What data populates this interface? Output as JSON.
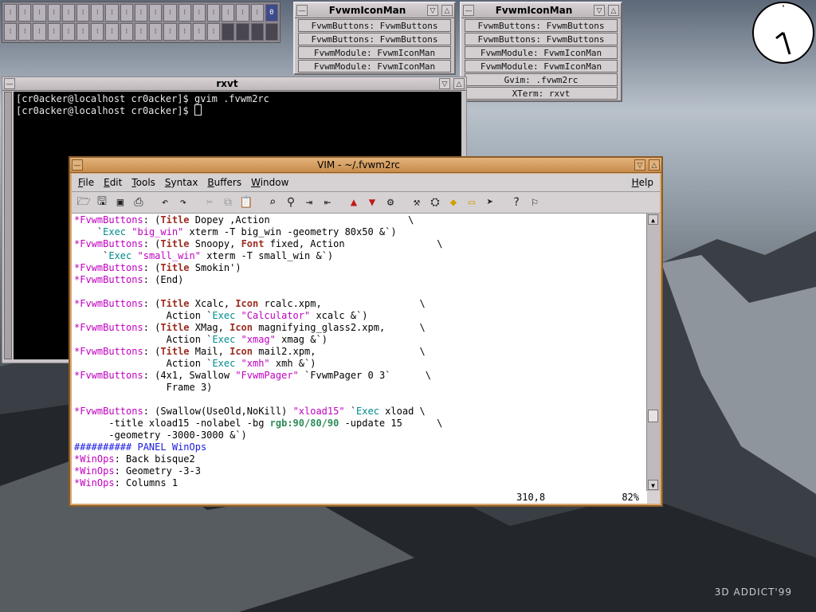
{
  "desktop": {
    "watermark": "3D ADDICT'99"
  },
  "pager": {
    "active_label": "0"
  },
  "iconman_left": {
    "title": "FvwmIconMan",
    "items": [
      "FvwmButtons: FvwmButtons",
      "FvwmButtons: FvwmButtons",
      "FvwmModule: FvwmIconMan",
      "FvwmModule: FvwmIconMan"
    ]
  },
  "iconman_right": {
    "title": "FvwmIconMan",
    "items": [
      "FvwmButtons: FvwmButtons",
      "FvwmButtons: FvwmButtons",
      "FvwmModule: FvwmIconMan",
      "FvwmModule: FvwmIconMan",
      "Gvim: .fvwm2rc",
      "XTerm: rxvt"
    ]
  },
  "rxvt": {
    "title": "rxvt",
    "line1": "[cr0acker@localhost cr0acker]$ gvim .fvwm2rc",
    "line2": "[cr0acker@localhost cr0acker]$ "
  },
  "vim": {
    "title": "VIM - ~/.fvwm2rc",
    "menu": [
      "File",
      "Edit",
      "Tools",
      "Syntax",
      "Buffers",
      "Window"
    ],
    "help": "Help",
    "toolbar_icons": [
      "open-icon",
      "save-icon",
      "save-all-icon",
      "print-icon",
      "undo-icon",
      "redo-icon",
      "cut-icon",
      "copy-icon",
      "paste-icon",
      "find-icon",
      "find-replace-icon",
      "find-next-icon",
      "find-prev-icon",
      "load-session-icon",
      "save-session-icon",
      "run-script-icon",
      "make-icon",
      "build-icon",
      "tags-icon",
      "shell-icon",
      "jump-tag-icon",
      "help-icon",
      "find-help-icon"
    ],
    "status_position": "310,8",
    "status_percent": "82%",
    "code_lines": [
      [
        [
          "*",
          "s"
        ],
        [
          "FvwmButtons",
          "k"
        ],
        [
          ": (",
          ""
        ],
        [
          "Title",
          "t"
        ],
        [
          " Dopey ,Action                        \\",
          ""
        ]
      ],
      [
        [
          "    `",
          ""
        ],
        [
          "Exec",
          "e"
        ],
        [
          " ",
          ""
        ],
        [
          "\"big_win\"",
          "q"
        ],
        [
          " xterm -T big_win -geometry 80x50 &`)",
          ""
        ]
      ],
      [
        [
          "*",
          "s"
        ],
        [
          "FvwmButtons",
          "k"
        ],
        [
          ": (",
          ""
        ],
        [
          "Title",
          "t"
        ],
        [
          " Snoopy, ",
          ""
        ],
        [
          "Font",
          "t"
        ],
        [
          " fixed, Action                \\",
          ""
        ]
      ],
      [
        [
          "     `",
          ""
        ],
        [
          "Exec",
          "e"
        ],
        [
          " ",
          ""
        ],
        [
          "\"small_win\"",
          "q"
        ],
        [
          " xterm -T small_win &`)",
          ""
        ]
      ],
      [
        [
          "*",
          "s"
        ],
        [
          "FvwmButtons",
          "k"
        ],
        [
          ": (",
          ""
        ],
        [
          "Title",
          "t"
        ],
        [
          " Smokin')",
          ""
        ]
      ],
      [
        [
          "*",
          "s"
        ],
        [
          "FvwmButtons",
          "k"
        ],
        [
          ": (End)",
          ""
        ]
      ],
      [
        [
          "",
          ""
        ]
      ],
      [
        [
          "*",
          "s"
        ],
        [
          "FvwmButtons",
          "k"
        ],
        [
          ": (",
          ""
        ],
        [
          "Title",
          "t"
        ],
        [
          " Xcalc, ",
          ""
        ],
        [
          "Icon",
          "t"
        ],
        [
          " rcalc.xpm,                 \\",
          ""
        ]
      ],
      [
        [
          "                Action `",
          ""
        ],
        [
          "Exec",
          "e"
        ],
        [
          " ",
          ""
        ],
        [
          "\"Calculator\"",
          "q"
        ],
        [
          " xcalc &`)",
          ""
        ]
      ],
      [
        [
          "*",
          "s"
        ],
        [
          "FvwmButtons",
          "k"
        ],
        [
          ": (",
          ""
        ],
        [
          "Title",
          "t"
        ],
        [
          " XMag, ",
          ""
        ],
        [
          "Icon",
          "t"
        ],
        [
          " magnifying_glass2.xpm,      \\",
          ""
        ]
      ],
      [
        [
          "                Action `",
          ""
        ],
        [
          "Exec",
          "e"
        ],
        [
          " ",
          ""
        ],
        [
          "\"xmag\"",
          "q"
        ],
        [
          " xmag &`)",
          ""
        ]
      ],
      [
        [
          "*",
          "s"
        ],
        [
          "FvwmButtons",
          "k"
        ],
        [
          ": (",
          ""
        ],
        [
          "Title",
          "t"
        ],
        [
          " Mail, ",
          ""
        ],
        [
          "Icon",
          "t"
        ],
        [
          " mail2.xpm,                  \\",
          ""
        ]
      ],
      [
        [
          "                Action `",
          ""
        ],
        [
          "Exec",
          "e"
        ],
        [
          " ",
          ""
        ],
        [
          "\"xmh\"",
          "q"
        ],
        [
          " xmh &`)",
          ""
        ]
      ],
      [
        [
          "*",
          "s"
        ],
        [
          "FvwmButtons",
          "k"
        ],
        [
          ": (4x1, Swallow ",
          ""
        ],
        [
          "\"FvwmPager\"",
          "q"
        ],
        [
          " `FvwmPager 0 3`      \\",
          ""
        ]
      ],
      [
        [
          "                Frame 3)",
          ""
        ]
      ],
      [
        [
          "",
          ""
        ]
      ],
      [
        [
          "*",
          "s"
        ],
        [
          "FvwmButtons",
          "k"
        ],
        [
          ": (Swallow(UseOld,NoKill) ",
          ""
        ],
        [
          "\"xload15\"",
          "q"
        ],
        [
          " `",
          ""
        ],
        [
          "Exec",
          "e"
        ],
        [
          " xload \\",
          ""
        ]
      ],
      [
        [
          "      -title xload15 -nolabel -bg ",
          ""
        ],
        [
          "rgb:90/80/90",
          "g"
        ],
        [
          " -update 15      \\",
          ""
        ]
      ],
      [
        [
          "      -geometry -3000-3000 &`)",
          ""
        ]
      ],
      [
        [
          "########## PANEL WinOps",
          "b"
        ]
      ],
      [
        [
          "*",
          "s"
        ],
        [
          "WinOps",
          "k"
        ],
        [
          ": Back bisque2",
          ""
        ]
      ],
      [
        [
          "*",
          "s"
        ],
        [
          "WinOps",
          "k"
        ],
        [
          ": Geometry -3-3",
          ""
        ]
      ],
      [
        [
          "*",
          "s"
        ],
        [
          "WinOps",
          "k"
        ],
        [
          ": Columns 1",
          ""
        ]
      ]
    ]
  }
}
